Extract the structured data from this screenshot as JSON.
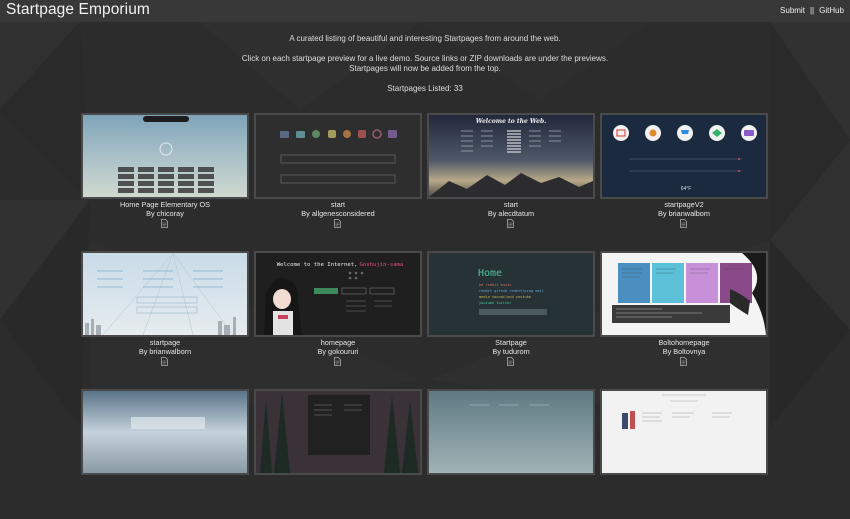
{
  "header": {
    "title": "Startpage Emporium",
    "nav": [
      {
        "label": "Submit"
      },
      {
        "separator": "||"
      },
      {
        "label": "GitHub"
      }
    ]
  },
  "intro": {
    "line1": "A curated listing of beautiful and interesting Startpages from around the web.",
    "line2": "Click on each startpage preview for a live demo. Source links or ZIP downloads are under the previews.",
    "line3": "Startpages will now be added from the top.",
    "count_text": "Startpages Listed: 33"
  },
  "cards": [
    {
      "title": "Home Page Elementary OS",
      "author": "By chicoray"
    },
    {
      "title": "start",
      "author": "By allgenesconsidered"
    },
    {
      "title": "start",
      "author": "By alecdtatum"
    },
    {
      "title": "startpageV2",
      "author": "By brianwalbom"
    },
    {
      "title": "startpage",
      "author": "By brianwalborn"
    },
    {
      "title": "homepage",
      "author": "By gokoururi"
    },
    {
      "title": "Startpage",
      "author": "By tudurom"
    },
    {
      "title": "Boltohomepage",
      "author": "By Boltovnya"
    }
  ],
  "previews": {
    "card3_heading": "Welcome to the Web.",
    "card4_temperature": "64°F",
    "card6_heading_prefix": "Welcome to the Internet,",
    "card6_heading_name": "Goshujin-sama",
    "card7_heading": "Home"
  },
  "colors": {
    "background": "#2c2c2c",
    "header": "#383838",
    "card_border": "#4a4a4a",
    "home_green": "#4fc3a1",
    "goshujin_pink": "#e94a8a"
  },
  "icons": [
    "document-icon"
  ]
}
